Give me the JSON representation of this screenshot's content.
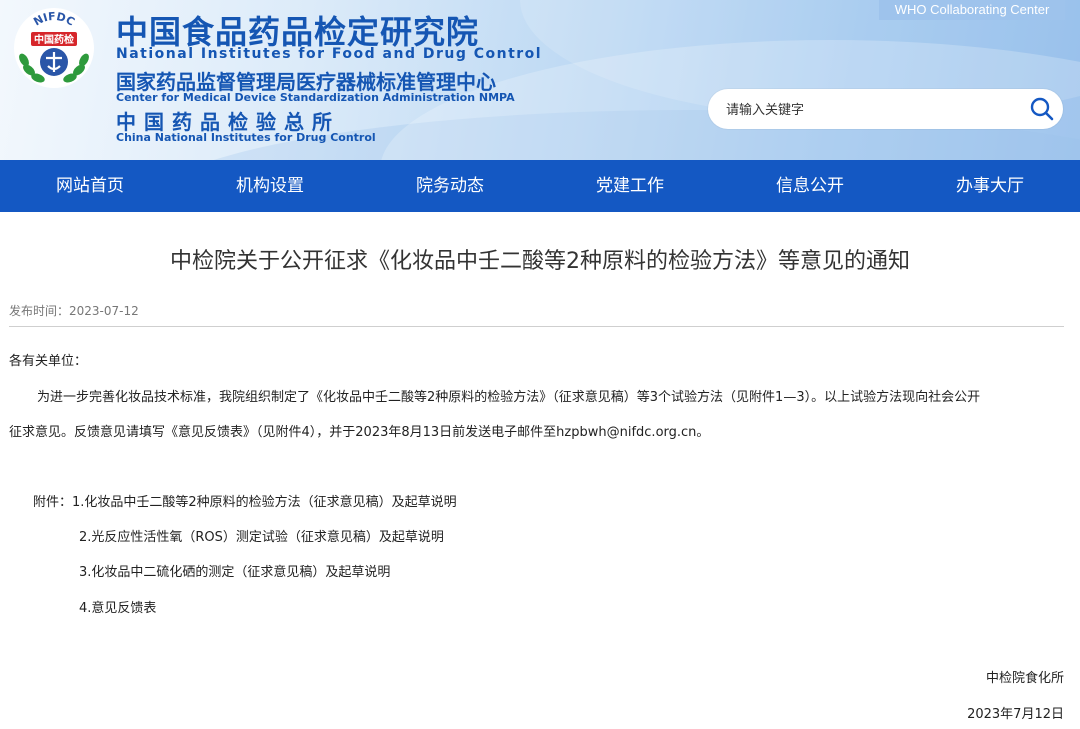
{
  "header": {
    "logo_ring_text": "NIFDC",
    "logo_center_text": "中国药检",
    "title_cn": "中国食品药品检定研究院",
    "title_en": "National Institutes for Food and Drug Control",
    "subtitle2_cn": "国家药品监督管理局医疗器械标准管理中心",
    "subtitle2_en": "Center for Medical Device Standardization Administration NMPA",
    "subtitle3_cn": "中国药品检验总所",
    "subtitle3_en": "China National Institutes for Drug Control",
    "who_badge": "WHO Collaborating Center",
    "brand_color": "#1556b3"
  },
  "search": {
    "placeholder": "请输入关键字",
    "icon": "search-icon"
  },
  "nav": {
    "background": "#1458c3",
    "items": [
      "网站首页",
      "机构设置",
      "院务动态",
      "党建工作",
      "信息公开",
      "办事大厅"
    ]
  },
  "article": {
    "title": "中检院关于公开征求《化妆品中壬二酸等2种原料的检验方法》等意见的通知",
    "publish_time": "发布时间：2023-07-12",
    "greeting": "各有关单位：",
    "paragraph_line1": "为进一步完善化妆品技术标准，我院组织制定了《化妆品中壬二酸等2种原料的检验方法》（征求意见稿）等3个试验方法（见附件1—3）。以上试验方法现向社会公开",
    "paragraph_line2": "征求意见。反馈意见请填写《意见反馈表》（见附件4），并于2023年8月13日前发送电子邮件至hzpbwh@nifdc.org.cn。",
    "attachments": [
      "附件：1.化妆品中壬二酸等2种原料的检验方法（征求意见稿）及起草说明",
      "2.光反应性活性氧（ROS）测定试验（征求意见稿）及起草说明",
      "3.化妆品中二硫化硒的测定（征求意见稿）及起草说明",
      "4.意见反馈表"
    ],
    "signature_org": "中检院食化所",
    "signature_date": "2023年7月12日"
  }
}
